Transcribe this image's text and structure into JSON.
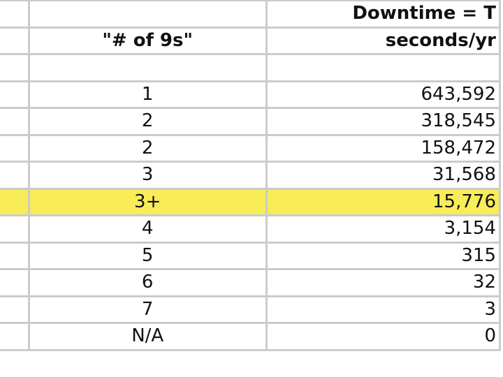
{
  "header": {
    "col_b_title": "\"# of 9s\"",
    "col_c_title_line1": "Downtime = T",
    "col_c_title_line2": "seconds/yr"
  },
  "highlight_color": "#f8ec59",
  "rows": [
    {
      "nines": "1",
      "downtime": "643,592",
      "highlighted": false
    },
    {
      "nines": "2",
      "downtime": "318,545",
      "highlighted": false
    },
    {
      "nines": "2",
      "downtime": "158,472",
      "highlighted": false
    },
    {
      "nines": "3",
      "downtime": "31,568",
      "highlighted": false
    },
    {
      "nines": "3+",
      "downtime": "15,776",
      "highlighted": true
    },
    {
      "nines": "4",
      "downtime": "3,154",
      "highlighted": false
    },
    {
      "nines": "5",
      "downtime": "315",
      "highlighted": false
    },
    {
      "nines": "6",
      "downtime": "32",
      "highlighted": false
    },
    {
      "nines": "7",
      "downtime": "3",
      "highlighted": false
    },
    {
      "nines": "N/A",
      "downtime": "0",
      "highlighted": false
    }
  ]
}
